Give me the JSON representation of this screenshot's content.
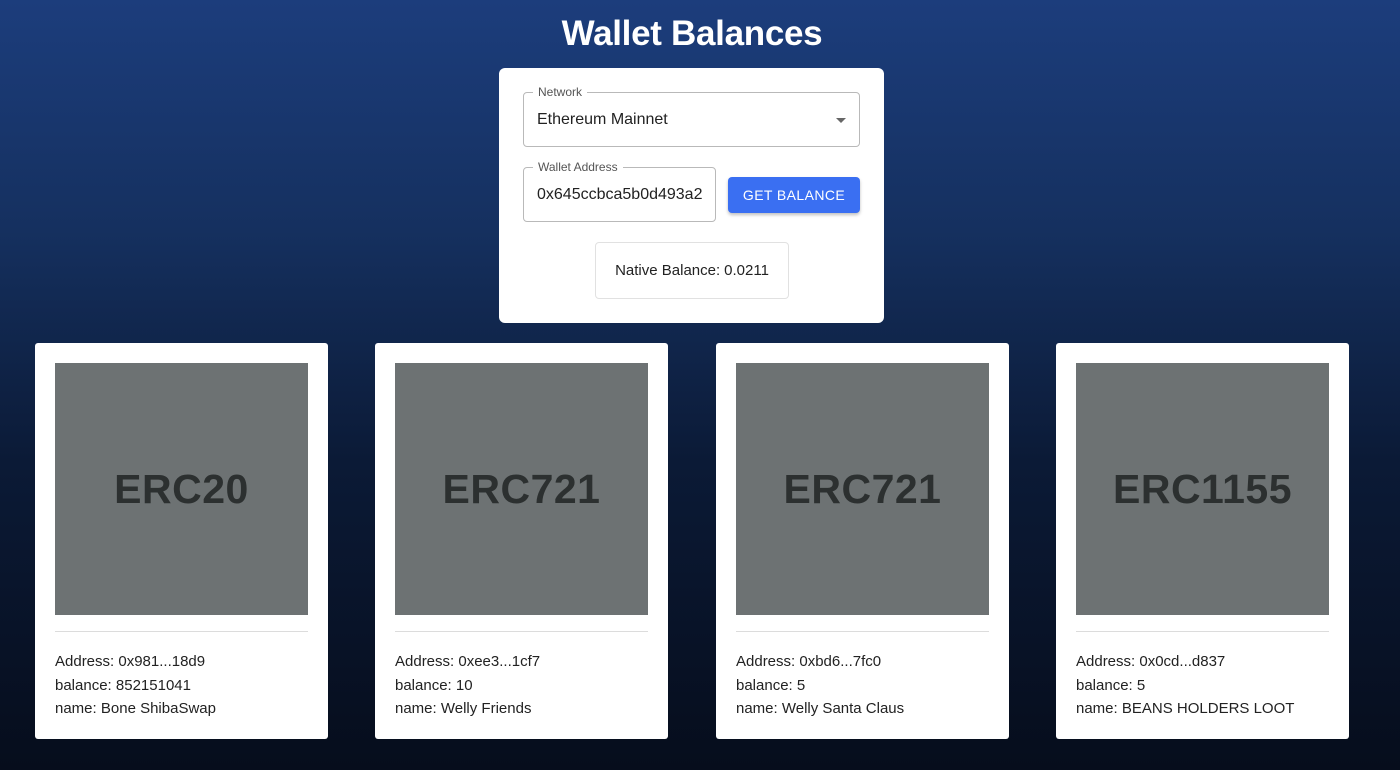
{
  "page": {
    "title": "Wallet Balances"
  },
  "form": {
    "network": {
      "legend": "Network",
      "value": "Ethereum Mainnet"
    },
    "wallet": {
      "legend": "Wallet Address",
      "value": "0x645ccbca5b0d493a2"
    },
    "button_label": "GET BALANCE",
    "native_balance": {
      "label": "Native Balance:",
      "value": "0.0211"
    }
  },
  "labels": {
    "address": "Address:",
    "balance": "balance:",
    "name": "name:"
  },
  "tokens": [
    {
      "type": "ERC20",
      "address": "0x981...18d9",
      "balance": "852151041",
      "name": "Bone ShibaSwap"
    },
    {
      "type": "ERC721",
      "address": "0xee3...1cf7",
      "balance": "10",
      "name": "Welly Friends"
    },
    {
      "type": "ERC721",
      "address": "0xbd6...7fc0",
      "balance": "5",
      "name": "Welly Santa Claus"
    },
    {
      "type": "ERC1155",
      "address": "0x0cd...d837",
      "balance": "5",
      "name": "BEANS HOLDERS LOOT"
    }
  ],
  "colors": {
    "button": "#3a6ff2",
    "thumbnail": "#6d7273",
    "background_top": "#1c3d7c",
    "background_bottom": "#060d1c"
  }
}
